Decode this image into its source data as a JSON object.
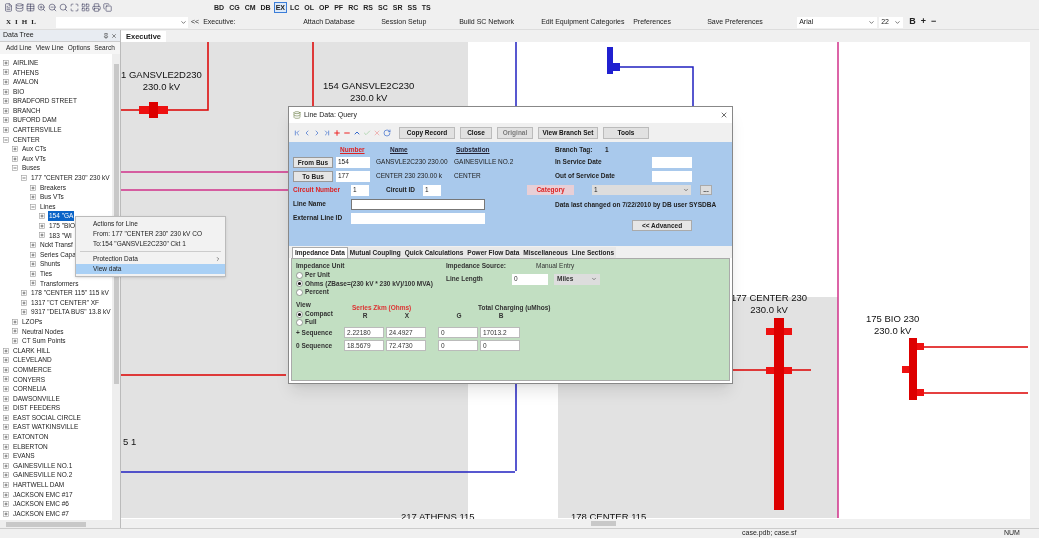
{
  "modules": [
    {
      "label": "BD",
      "selected": false
    },
    {
      "label": "CG",
      "selected": false
    },
    {
      "label": "CM",
      "selected": false
    },
    {
      "label": "DB",
      "selected": false
    },
    {
      "label": "EX",
      "selected": true
    },
    {
      "label": "LC",
      "selected": false
    },
    {
      "label": "OL",
      "selected": false
    },
    {
      "label": "OP",
      "selected": false
    },
    {
      "label": "PF",
      "selected": false
    },
    {
      "label": "RC",
      "selected": false
    },
    {
      "label": "RS",
      "selected": false
    },
    {
      "label": "SC",
      "selected": false
    },
    {
      "label": "SR",
      "selected": false
    },
    {
      "label": "SS",
      "selected": false
    },
    {
      "label": "TS",
      "selected": false
    }
  ],
  "command_bar": {
    "format_buttons": [
      "X",
      "I",
      "H",
      "L"
    ],
    "collapse": "<<",
    "view_label": "Executive:",
    "menu": [
      "Attach Database",
      "Session Setup",
      "Build SC Network",
      "Edit Equipment Categories",
      "Preferences",
      "Save Preferences"
    ],
    "font": "Arial",
    "font_size": "22",
    "style_buttons": [
      "B",
      "+",
      "−"
    ]
  },
  "data_tree": {
    "title": "Data Tree",
    "menu": [
      "Add Line",
      "View Line",
      "Options",
      "Search"
    ],
    "items": [
      {
        "label": "AIRLINE",
        "expanded": false,
        "selected": false
      },
      {
        "label": "ATHENS",
        "expanded": false,
        "selected": false
      },
      {
        "label": "AVALON",
        "expanded": false,
        "selected": false
      },
      {
        "label": "BIO",
        "expanded": false,
        "selected": false
      },
      {
        "label": "BRADFORD STREET",
        "expanded": false,
        "selected": false
      },
      {
        "label": "BRANCH",
        "expanded": false,
        "selected": false
      },
      {
        "label": "BUFORD DAM",
        "expanded": false,
        "selected": false
      },
      {
        "label": "CARTERSVILLE",
        "expanded": false,
        "selected": false
      },
      {
        "label": "CENTER",
        "expanded": true,
        "selected": false,
        "children": [
          {
            "label": "Aux CTs",
            "expanded": false,
            "selected": false
          },
          {
            "label": "Aux VTs",
            "expanded": false,
            "selected": false
          },
          {
            "label": "Buses",
            "expanded": true,
            "selected": false,
            "children": [
              {
                "label": "177 \"CENTER 230\" 230 kV",
                "expanded": true,
                "selected": false,
                "children": [
                  {
                    "label": "Breakers",
                    "expanded": false,
                    "selected": false
                  },
                  {
                    "label": "Bus VTs",
                    "expanded": false,
                    "selected": false
                  },
                  {
                    "label": "Lines",
                    "expanded": true,
                    "selected": false,
                    "children": [
                      {
                        "label": "154 \"GA",
                        "expanded": false,
                        "selected": true
                      },
                      {
                        "label": "175 \"BIO",
                        "expanded": false,
                        "selected": false
                      },
                      {
                        "label": "183 \"WI",
                        "expanded": false,
                        "selected": false
                      }
                    ]
                  },
                  {
                    "label": "Nckt Transf",
                    "expanded": false,
                    "selected": false
                  },
                  {
                    "label": "Series Capa",
                    "expanded": false,
                    "selected": false
                  },
                  {
                    "label": "Shunts",
                    "expanded": false,
                    "selected": false
                  },
                  {
                    "label": "Ties",
                    "expanded": false,
                    "selected": false
                  },
                  {
                    "label": "Transformers",
                    "expanded": false,
                    "selected": false
                  }
                ]
              },
              {
                "label": "178 \"CENTER 115\" 115 kV",
                "expanded": false,
                "selected": false
              },
              {
                "label": "1317 \"CT CENTER\" XF",
                "expanded": false,
                "selected": false
              },
              {
                "label": "9317 \"DELTA BUS\" 13.8 kV",
                "expanded": false,
                "selected": false
              }
            ]
          },
          {
            "label": "LZOPs",
            "expanded": false,
            "selected": false
          },
          {
            "label": "Neutral Nodes",
            "expanded": false,
            "selected": false
          },
          {
            "label": "CT Sum Points",
            "expanded": false,
            "selected": false
          }
        ]
      },
      {
        "label": "CLARK HILL",
        "expanded": false,
        "selected": false
      },
      {
        "label": "CLEVELAND",
        "expanded": false,
        "selected": false
      },
      {
        "label": "COMMERCE",
        "expanded": false,
        "selected": false
      },
      {
        "label": "CONYERS",
        "expanded": false,
        "selected": false
      },
      {
        "label": "CORNELIA",
        "expanded": false,
        "selected": false
      },
      {
        "label": "DAWSONVILLE",
        "expanded": false,
        "selected": false
      },
      {
        "label": "DIST FEEDERS",
        "expanded": false,
        "selected": false
      },
      {
        "label": "EAST SOCIAL CIRCLE",
        "expanded": false,
        "selected": false
      },
      {
        "label": "EAST WATKINSVILLE",
        "expanded": false,
        "selected": false
      },
      {
        "label": "EATONTON",
        "expanded": false,
        "selected": false
      },
      {
        "label": "ELBERTON",
        "expanded": false,
        "selected": false
      },
      {
        "label": "EVANS",
        "expanded": false,
        "selected": false
      },
      {
        "label": "GAINESVILLE NO.1",
        "expanded": false,
        "selected": false
      },
      {
        "label": "GAINESVILLE NO.2",
        "expanded": false,
        "selected": false
      },
      {
        "label": "HARTWELL DAM",
        "expanded": false,
        "selected": false
      },
      {
        "label": "JACKSON EMC #17",
        "expanded": false,
        "selected": false
      },
      {
        "label": "JACKSON EMC #6",
        "expanded": false,
        "selected": false
      },
      {
        "label": "JACKSON EMC #7",
        "expanded": false,
        "selected": false
      }
    ]
  },
  "tabs": [
    {
      "label": "Executive",
      "selected": true
    }
  ],
  "canvas": {
    "buses": [
      {
        "name": "1 GANSVLE2D230",
        "voltage": "230.0 kV"
      },
      {
        "name": "154 GANSVLE2C230",
        "voltage": "230.0 kV"
      },
      {
        "name": "177 CENTER 230",
        "voltage": "230.0 kV"
      },
      {
        "name": "175 BIO 230",
        "voltage": "230.0 kV"
      }
    ],
    "fragments": [
      "5 1",
      "217 ATHENS 115",
      "178 CENTER 115"
    ]
  },
  "context_menu": {
    "items": [
      {
        "label": "Actions for Line",
        "kind": "info",
        "selected": false
      },
      {
        "label": "From:  177 \"CENTER 230\" 230 kV CO",
        "kind": "info",
        "selected": false
      },
      {
        "label": "To:154 \"GANSVLE2C230\" Ckt 1",
        "kind": "info",
        "selected": false
      },
      {
        "label": "Protection Data",
        "kind": "submenu",
        "selected": false
      },
      {
        "label": "View data",
        "kind": "item",
        "selected": true
      }
    ]
  },
  "dialog": {
    "title": "Line Data: Query",
    "buttons": [
      {
        "label": "Copy Record",
        "disabled": false
      },
      {
        "label": "Close",
        "disabled": false
      },
      {
        "label": "Original",
        "disabled": true
      },
      {
        "label": "View Branch Set",
        "disabled": false
      },
      {
        "label": "Tools",
        "disabled": false
      }
    ],
    "headers": {
      "number": "Number",
      "name": "Name",
      "substation": "Substation"
    },
    "branch_tag": {
      "label": "Branch Tag:",
      "value": "1"
    },
    "bus_rows": [
      {
        "button": "From Bus",
        "number": "154",
        "name": "GANSVLE2C230 230.00",
        "substation": "GAINESVILLE NO.2",
        "date_label": "In Service Date"
      },
      {
        "button": "To Bus",
        "number": "177",
        "name": "CENTER 230  230.00 k",
        "substation": "CENTER",
        "date_label": "Out of Service Date"
      }
    ],
    "circuit_number": {
      "label": "Circuit Number",
      "value": "1"
    },
    "circuit_id": {
      "label": "Circuit ID",
      "value": "1"
    },
    "category": {
      "button": "Category",
      "value": "1",
      "more": "..."
    },
    "line_name": {
      "label": "Line Name"
    },
    "external_line_id": {
      "label": "External Line ID"
    },
    "last_changed": "Data last changed on 7/22/2010 by DB user SYSDBA",
    "advanced": "<< Advanced",
    "tabs": [
      {
        "label": "Impedance Data",
        "selected": true
      },
      {
        "label": "Mutual Coupling",
        "selected": false
      },
      {
        "label": "Quick Calculations",
        "selected": false
      },
      {
        "label": "Power Flow Data",
        "selected": false
      },
      {
        "label": "Miscellaneous",
        "selected": false
      },
      {
        "label": "Line Sections",
        "selected": false
      }
    ],
    "impedance": {
      "unit_label": "Impedance Unit",
      "units": [
        {
          "label": "Per Unit",
          "selected": false
        },
        {
          "label": "Ohms (ZBase=(230 kV * 230 kV)/100 MVA)",
          "selected": true
        },
        {
          "label": "Percent",
          "selected": false
        }
      ],
      "source_label": "Impedance Source:",
      "source": "Manual Entry",
      "length_label": "Line Length",
      "length": "0",
      "length_unit": "Miles",
      "view_label": "View",
      "views": [
        {
          "label": "Compact",
          "selected": true
        },
        {
          "label": "Full",
          "selected": false
        }
      ],
      "series_title": "Series Zkm (Ohms)",
      "charging_title": "Total Charging (uMhos)",
      "columns": [
        "R",
        "X",
        "G",
        "B"
      ],
      "rows": [
        {
          "label": "+ Sequence",
          "values": [
            "2.22180",
            "24.4927",
            "0",
            "17013.2"
          ]
        },
        {
          "label": "0 Sequence",
          "values": [
            "18.5679",
            "72.4730",
            "0",
            "0"
          ]
        }
      ]
    }
  },
  "status_bar": [
    "case.pdb; case.sf",
    "NUM"
  ]
}
